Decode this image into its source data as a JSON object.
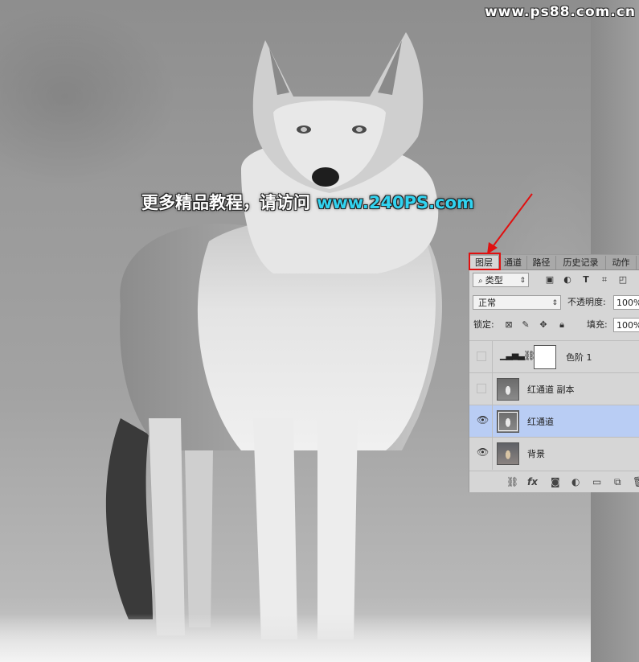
{
  "watermark": {
    "site": "www.ps88.com.cn"
  },
  "promo": {
    "text": "更多精品教程，请访问",
    "url": "www.240PS.com"
  },
  "layers_panel": {
    "tabs": [
      "图层",
      "通道",
      "路径",
      "历史记录",
      "动作"
    ],
    "active_tab": "图层",
    "filter": {
      "label": "类型"
    },
    "blend_mode": "正常",
    "opacity": {
      "label": "不透明度:",
      "value": "100%"
    },
    "lock_label": "锁定:",
    "fill": {
      "label": "填充:",
      "value": "100%"
    },
    "layers": [
      {
        "name": "色阶 1",
        "visible": false,
        "kind": "adjustment"
      },
      {
        "name": "红通道 副本",
        "visible": false,
        "kind": "gray"
      },
      {
        "name": "红通道",
        "visible": true,
        "kind": "gray",
        "selected": true
      },
      {
        "name": "背景",
        "visible": true,
        "kind": "color"
      }
    ],
    "footer_icons": [
      "link-icon",
      "fx-icon",
      "mask-icon",
      "adjustment-icon",
      "folder-icon",
      "new-layer-icon",
      "trash-icon"
    ]
  },
  "colors": {
    "selected_layer": "#b9cdf4",
    "highlight_box": "#e01010",
    "promo_url": "#31d3f0"
  }
}
